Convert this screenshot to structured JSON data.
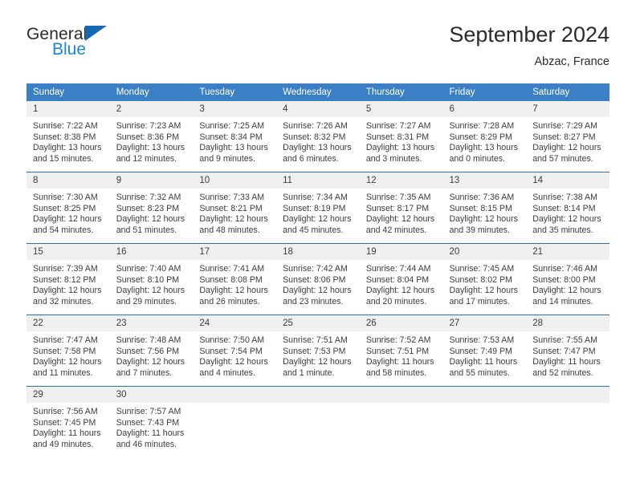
{
  "brand": {
    "name_dark": "General",
    "name_blue": "Blue",
    "triangle_color": "#1668b3",
    "blue_color": "#1a86d8"
  },
  "header": {
    "title": "September 2024",
    "subtitle": "Abzac, France"
  },
  "theme": {
    "header_bg": "#3b7fc4",
    "row_divider": "#2f6fae",
    "daynum_bg": "#f0f0f0",
    "text": "#3c3c3c"
  },
  "weekday_headers": [
    "Sunday",
    "Monday",
    "Tuesday",
    "Wednesday",
    "Thursday",
    "Friday",
    "Saturday"
  ],
  "weeks": [
    {
      "days": [
        {
          "num": "1",
          "sunrise": "Sunrise: 7:22 AM",
          "sunset": "Sunset: 8:38 PM",
          "daylight_1": "Daylight: 13 hours",
          "daylight_2": "and 15 minutes."
        },
        {
          "num": "2",
          "sunrise": "Sunrise: 7:23 AM",
          "sunset": "Sunset: 8:36 PM",
          "daylight_1": "Daylight: 13 hours",
          "daylight_2": "and 12 minutes."
        },
        {
          "num": "3",
          "sunrise": "Sunrise: 7:25 AM",
          "sunset": "Sunset: 8:34 PM",
          "daylight_1": "Daylight: 13 hours",
          "daylight_2": "and 9 minutes."
        },
        {
          "num": "4",
          "sunrise": "Sunrise: 7:26 AM",
          "sunset": "Sunset: 8:32 PM",
          "daylight_1": "Daylight: 13 hours",
          "daylight_2": "and 6 minutes."
        },
        {
          "num": "5",
          "sunrise": "Sunrise: 7:27 AM",
          "sunset": "Sunset: 8:31 PM",
          "daylight_1": "Daylight: 13 hours",
          "daylight_2": "and 3 minutes."
        },
        {
          "num": "6",
          "sunrise": "Sunrise: 7:28 AM",
          "sunset": "Sunset: 8:29 PM",
          "daylight_1": "Daylight: 13 hours",
          "daylight_2": "and 0 minutes."
        },
        {
          "num": "7",
          "sunrise": "Sunrise: 7:29 AM",
          "sunset": "Sunset: 8:27 PM",
          "daylight_1": "Daylight: 12 hours",
          "daylight_2": "and 57 minutes."
        }
      ]
    },
    {
      "days": [
        {
          "num": "8",
          "sunrise": "Sunrise: 7:30 AM",
          "sunset": "Sunset: 8:25 PM",
          "daylight_1": "Daylight: 12 hours",
          "daylight_2": "and 54 minutes."
        },
        {
          "num": "9",
          "sunrise": "Sunrise: 7:32 AM",
          "sunset": "Sunset: 8:23 PM",
          "daylight_1": "Daylight: 12 hours",
          "daylight_2": "and 51 minutes."
        },
        {
          "num": "10",
          "sunrise": "Sunrise: 7:33 AM",
          "sunset": "Sunset: 8:21 PM",
          "daylight_1": "Daylight: 12 hours",
          "daylight_2": "and 48 minutes."
        },
        {
          "num": "11",
          "sunrise": "Sunrise: 7:34 AM",
          "sunset": "Sunset: 8:19 PM",
          "daylight_1": "Daylight: 12 hours",
          "daylight_2": "and 45 minutes."
        },
        {
          "num": "12",
          "sunrise": "Sunrise: 7:35 AM",
          "sunset": "Sunset: 8:17 PM",
          "daylight_1": "Daylight: 12 hours",
          "daylight_2": "and 42 minutes."
        },
        {
          "num": "13",
          "sunrise": "Sunrise: 7:36 AM",
          "sunset": "Sunset: 8:15 PM",
          "daylight_1": "Daylight: 12 hours",
          "daylight_2": "and 39 minutes."
        },
        {
          "num": "14",
          "sunrise": "Sunrise: 7:38 AM",
          "sunset": "Sunset: 8:14 PM",
          "daylight_1": "Daylight: 12 hours",
          "daylight_2": "and 35 minutes."
        }
      ]
    },
    {
      "days": [
        {
          "num": "15",
          "sunrise": "Sunrise: 7:39 AM",
          "sunset": "Sunset: 8:12 PM",
          "daylight_1": "Daylight: 12 hours",
          "daylight_2": "and 32 minutes."
        },
        {
          "num": "16",
          "sunrise": "Sunrise: 7:40 AM",
          "sunset": "Sunset: 8:10 PM",
          "daylight_1": "Daylight: 12 hours",
          "daylight_2": "and 29 minutes."
        },
        {
          "num": "17",
          "sunrise": "Sunrise: 7:41 AM",
          "sunset": "Sunset: 8:08 PM",
          "daylight_1": "Daylight: 12 hours",
          "daylight_2": "and 26 minutes."
        },
        {
          "num": "18",
          "sunrise": "Sunrise: 7:42 AM",
          "sunset": "Sunset: 8:06 PM",
          "daylight_1": "Daylight: 12 hours",
          "daylight_2": "and 23 minutes."
        },
        {
          "num": "19",
          "sunrise": "Sunrise: 7:44 AM",
          "sunset": "Sunset: 8:04 PM",
          "daylight_1": "Daylight: 12 hours",
          "daylight_2": "and 20 minutes."
        },
        {
          "num": "20",
          "sunrise": "Sunrise: 7:45 AM",
          "sunset": "Sunset: 8:02 PM",
          "daylight_1": "Daylight: 12 hours",
          "daylight_2": "and 17 minutes."
        },
        {
          "num": "21",
          "sunrise": "Sunrise: 7:46 AM",
          "sunset": "Sunset: 8:00 PM",
          "daylight_1": "Daylight: 12 hours",
          "daylight_2": "and 14 minutes."
        }
      ]
    },
    {
      "days": [
        {
          "num": "22",
          "sunrise": "Sunrise: 7:47 AM",
          "sunset": "Sunset: 7:58 PM",
          "daylight_1": "Daylight: 12 hours",
          "daylight_2": "and 11 minutes."
        },
        {
          "num": "23",
          "sunrise": "Sunrise: 7:48 AM",
          "sunset": "Sunset: 7:56 PM",
          "daylight_1": "Daylight: 12 hours",
          "daylight_2": "and 7 minutes."
        },
        {
          "num": "24",
          "sunrise": "Sunrise: 7:50 AM",
          "sunset": "Sunset: 7:54 PM",
          "daylight_1": "Daylight: 12 hours",
          "daylight_2": "and 4 minutes."
        },
        {
          "num": "25",
          "sunrise": "Sunrise: 7:51 AM",
          "sunset": "Sunset: 7:53 PM",
          "daylight_1": "Daylight: 12 hours",
          "daylight_2": "and 1 minute."
        },
        {
          "num": "26",
          "sunrise": "Sunrise: 7:52 AM",
          "sunset": "Sunset: 7:51 PM",
          "daylight_1": "Daylight: 11 hours",
          "daylight_2": "and 58 minutes."
        },
        {
          "num": "27",
          "sunrise": "Sunrise: 7:53 AM",
          "sunset": "Sunset: 7:49 PM",
          "daylight_1": "Daylight: 11 hours",
          "daylight_2": "and 55 minutes."
        },
        {
          "num": "28",
          "sunrise": "Sunrise: 7:55 AM",
          "sunset": "Sunset: 7:47 PM",
          "daylight_1": "Daylight: 11 hours",
          "daylight_2": "and 52 minutes."
        }
      ]
    },
    {
      "days": [
        {
          "num": "29",
          "sunrise": "Sunrise: 7:56 AM",
          "sunset": "Sunset: 7:45 PM",
          "daylight_1": "Daylight: 11 hours",
          "daylight_2": "and 49 minutes."
        },
        {
          "num": "30",
          "sunrise": "Sunrise: 7:57 AM",
          "sunset": "Sunset: 7:43 PM",
          "daylight_1": "Daylight: 11 hours",
          "daylight_2": "and 46 minutes."
        },
        {
          "num": "",
          "sunrise": "",
          "sunset": "",
          "daylight_1": "",
          "daylight_2": ""
        },
        {
          "num": "",
          "sunrise": "",
          "sunset": "",
          "daylight_1": "",
          "daylight_2": ""
        },
        {
          "num": "",
          "sunrise": "",
          "sunset": "",
          "daylight_1": "",
          "daylight_2": ""
        },
        {
          "num": "",
          "sunrise": "",
          "sunset": "",
          "daylight_1": "",
          "daylight_2": ""
        },
        {
          "num": "",
          "sunrise": "",
          "sunset": "",
          "daylight_1": "",
          "daylight_2": ""
        }
      ]
    }
  ]
}
